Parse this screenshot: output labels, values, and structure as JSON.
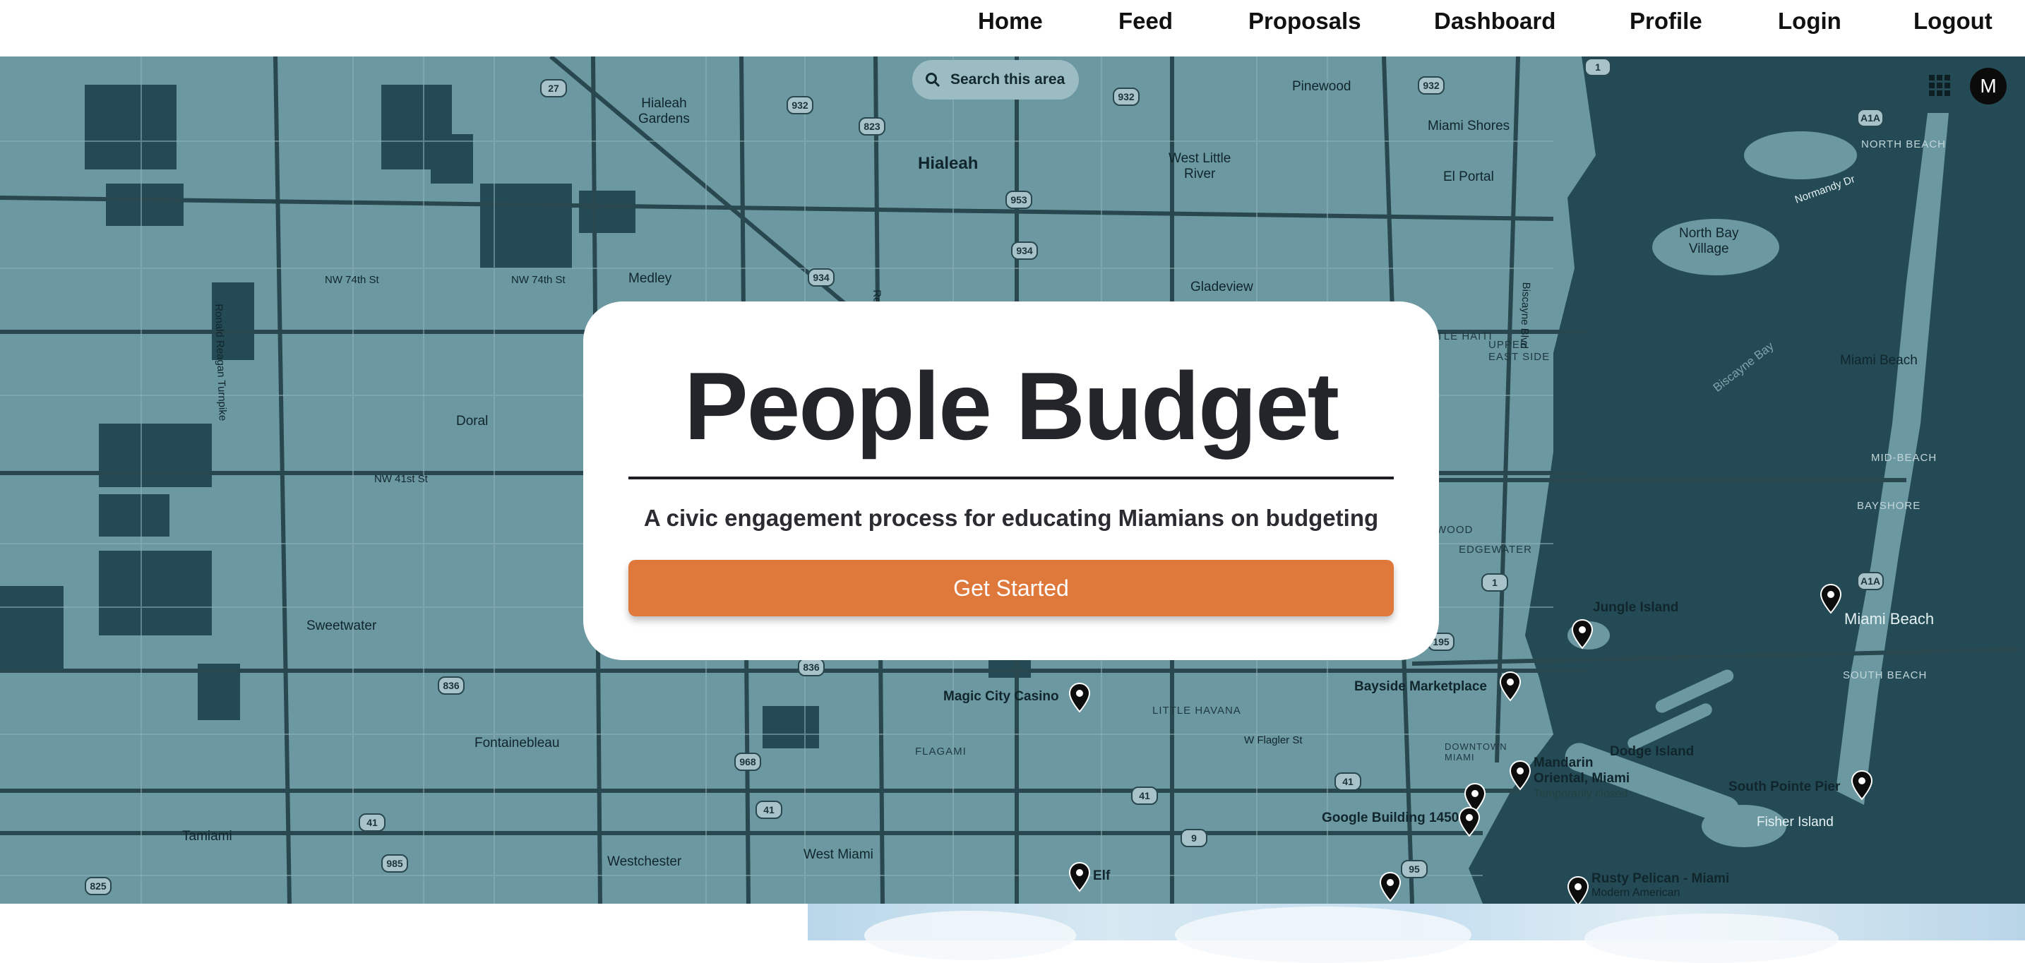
{
  "nav": {
    "items": [
      "Home",
      "Feed",
      "Proposals",
      "Dashboard",
      "Profile",
      "Login",
      "Logout"
    ]
  },
  "map": {
    "search_label": "Search this area",
    "avatar_letter": "M",
    "labels": {
      "hialeah_gardens": "Hialeah\nGardens",
      "hialeah": "Hialeah",
      "west_little_river": "West Little\nRiver",
      "pinewood": "Pinewood",
      "miami_shores": "Miami Shores",
      "el_portal": "El Portal",
      "north_bay_village": "North Bay\nVillage",
      "miami_beach_n": "Miami Beach",
      "miami_beach_s": "Miami Beach",
      "medley": "Medley",
      "gladeview": "Gladeview",
      "doral": "Doral",
      "sweetwater": "Sweetwater",
      "fontainebleau": "Fontainebleau",
      "tamiami": "Tamiami",
      "westchester": "Westchester",
      "west_miami": "West Miami",
      "magic_city": "Magic City Casino",
      "bayside": "Bayside Marketplace",
      "jungle_island": "Jungle Island",
      "dodge_island": "Dodge Island",
      "mandarin": "Mandarin\nOriental, Miami",
      "temp_closed": "Temporarily closed",
      "south_pointe": "South Pointe Pier",
      "fisher_island": "Fisher Island",
      "google_building": "Google Building 1450",
      "elf": "Elf",
      "rusty_pelican": "Rusty Pelican - Miami",
      "modern_american": "Modern American",
      "nw74": "NW 74th St",
      "nw74b": "NW 74th St",
      "nw41": "NW 41st St",
      "w_flagler": "W Flagler St",
      "biscayne_bay": "Biscayne Bay",
      "normandy": "Normandy Dr",
      "little_haiti": "LITTLE HAITI",
      "upper_east_side": "UPPER\nEAST SIDE",
      "edgewater": "EDGEWATER",
      "little_havana": "LITTLE HAVANA",
      "flagami": "FLAGAMI",
      "downtown": "DOWNTOWN\nMIAMI",
      "north_beach": "NORTH BEACH",
      "mid_beach": "MID-BEACH",
      "bayshore": "BAYSHORE",
      "south_beach": "SOUTH BEACH",
      "wood": "WOOD",
      "ronald_reagan": "Ronald Reagan Turnpike",
      "red_rd": "Red Rd",
      "biscayne_blvd": "Biscayne Blvd"
    },
    "shields": [
      "27",
      "932",
      "823",
      "932",
      "932",
      "953",
      "934",
      "934",
      "1",
      "A1A",
      "836",
      "836",
      "968",
      "41",
      "41",
      "41",
      "41",
      "985",
      "825",
      "9",
      "95",
      "1",
      "A1A",
      "195"
    ]
  },
  "hero": {
    "title": "People Budget",
    "subtitle": "A civic engagement process for educating Miamians on budgeting",
    "cta_label": "Get Started"
  },
  "colors": {
    "map_land": "#6c98a2",
    "map_dark": "#244a55",
    "cta": "#df783b",
    "title": "#23252a"
  }
}
